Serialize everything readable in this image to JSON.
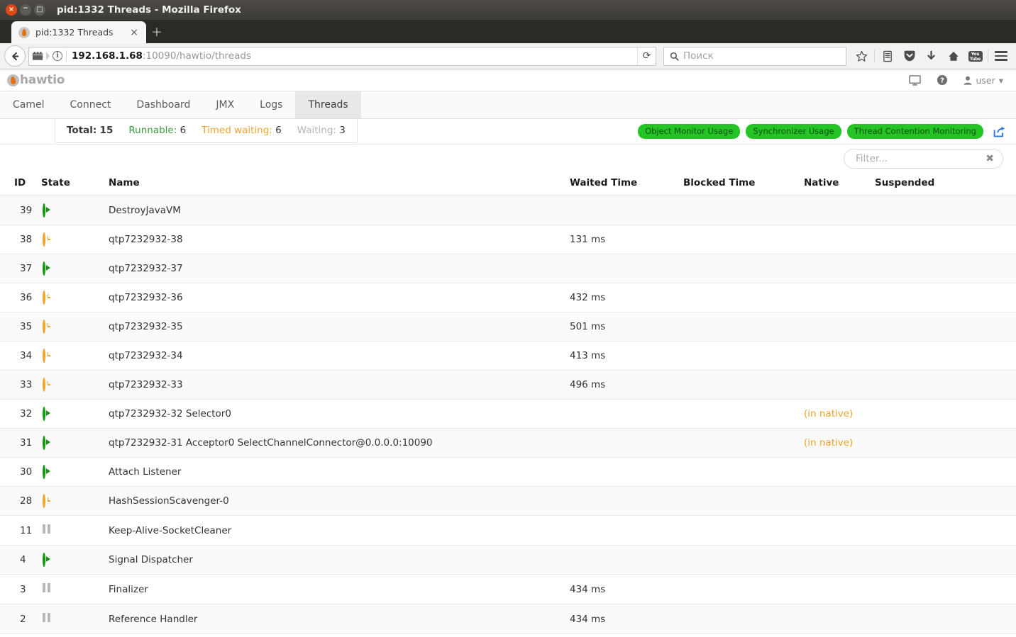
{
  "browser": {
    "window_title": "pid:1332 Threads - Mozilla Firefox",
    "close_glyph": "×",
    "minimize_glyph": "−",
    "maximize_glyph": "□",
    "tab": {
      "label": "pid:1332 Threads",
      "close_glyph": "×",
      "favicon_name": "hawtio-favicon"
    },
    "new_tab_glyph": "+",
    "back_glyph": "←",
    "info_glyph": "i",
    "url": {
      "host": "192.168.1.68",
      "path": ":10090/hawtio/threads"
    },
    "reload_glyph": "⟳",
    "search_placeholder": "Поиск",
    "search_value": "",
    "youtube_label_top": "You",
    "youtube_label_bottom": "Tube"
  },
  "app": {
    "brand": "hawtio",
    "user": "user",
    "user_caret": "▾"
  },
  "nav": {
    "tabs": [
      {
        "label": "Camel",
        "active": false
      },
      {
        "label": "Connect",
        "active": false
      },
      {
        "label": "Dashboard",
        "active": false
      },
      {
        "label": "JMX",
        "active": false
      },
      {
        "label": "Logs",
        "active": false
      },
      {
        "label": "Threads",
        "active": true
      }
    ]
  },
  "summary": {
    "total_label": "Total:",
    "total_value": "15",
    "runnable_label": "Runnable:",
    "runnable_value": "6",
    "timed_waiting_label": "Timed waiting:",
    "timed_waiting_value": "6",
    "waiting_label": "Waiting:",
    "waiting_value": "3"
  },
  "badges": [
    {
      "label": "Object Monitor Usage"
    },
    {
      "label": "Synchronizer Usage"
    },
    {
      "label": "Thread Contention Monitoring"
    }
  ],
  "filter": {
    "placeholder": "Filter...",
    "value": "",
    "clear_glyph": "✖"
  },
  "table": {
    "columns": [
      "ID",
      "State",
      "Name",
      "Waited Time",
      "Blocked Time",
      "Native",
      "Suspended"
    ],
    "rows": [
      {
        "id": "39",
        "state": "runnable",
        "name": "DestroyJavaVM",
        "waited": "",
        "blocked": "",
        "native": "",
        "suspended": ""
      },
      {
        "id": "38",
        "state": "timed-waiting",
        "name": "qtp7232932-38",
        "waited": "131 ms",
        "blocked": "",
        "native": "",
        "suspended": ""
      },
      {
        "id": "37",
        "state": "runnable",
        "name": "qtp7232932-37",
        "waited": "",
        "blocked": "",
        "native": "",
        "suspended": ""
      },
      {
        "id": "36",
        "state": "timed-waiting",
        "name": "qtp7232932-36",
        "waited": "432 ms",
        "blocked": "",
        "native": "",
        "suspended": ""
      },
      {
        "id": "35",
        "state": "timed-waiting",
        "name": "qtp7232932-35",
        "waited": "501 ms",
        "blocked": "",
        "native": "",
        "suspended": ""
      },
      {
        "id": "34",
        "state": "timed-waiting",
        "name": "qtp7232932-34",
        "waited": "413 ms",
        "blocked": "",
        "native": "",
        "suspended": ""
      },
      {
        "id": "33",
        "state": "timed-waiting",
        "name": "qtp7232932-33",
        "waited": "496 ms",
        "blocked": "",
        "native": "",
        "suspended": ""
      },
      {
        "id": "32",
        "state": "runnable",
        "name": "qtp7232932-32 Selector0",
        "waited": "",
        "blocked": "",
        "native": "(in native)",
        "suspended": ""
      },
      {
        "id": "31",
        "state": "runnable",
        "name": "qtp7232932-31 Acceptor0 SelectChannelConnector@0.0.0.0:10090",
        "waited": "",
        "blocked": "",
        "native": "(in native)",
        "suspended": ""
      },
      {
        "id": "30",
        "state": "runnable",
        "name": "Attach Listener",
        "waited": "",
        "blocked": "",
        "native": "",
        "suspended": ""
      },
      {
        "id": "28",
        "state": "timed-waiting",
        "name": "HashSessionScavenger-0",
        "waited": "",
        "blocked": "",
        "native": "",
        "suspended": ""
      },
      {
        "id": "11",
        "state": "waiting",
        "name": "Keep-Alive-SocketCleaner",
        "waited": "",
        "blocked": "",
        "native": "",
        "suspended": ""
      },
      {
        "id": "4",
        "state": "runnable",
        "name": "Signal Dispatcher",
        "waited": "",
        "blocked": "",
        "native": "",
        "suspended": ""
      },
      {
        "id": "3",
        "state": "waiting",
        "name": "Finalizer",
        "waited": "434 ms",
        "blocked": "",
        "native": "",
        "suspended": ""
      },
      {
        "id": "2",
        "state": "waiting",
        "name": "Reference Handler",
        "waited": "434 ms",
        "blocked": "",
        "native": "",
        "suspended": ""
      }
    ]
  },
  "colors": {
    "runnable": "#109910",
    "timed_waiting": "#f0a52b",
    "waiting": "#b8b8b8",
    "badge_bg": "#25c425",
    "brand_flame": "#e8700a",
    "link": "#2a7ae2"
  }
}
